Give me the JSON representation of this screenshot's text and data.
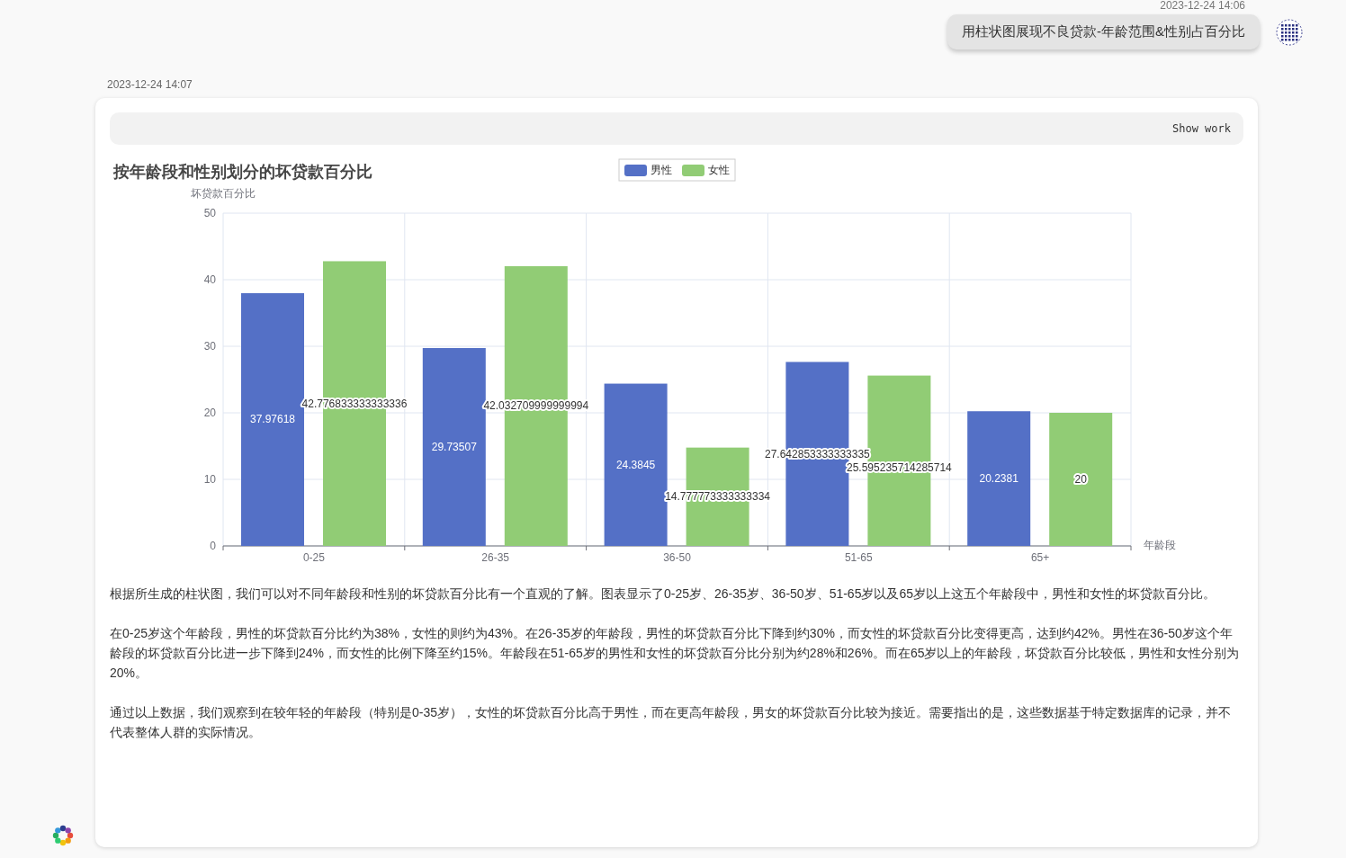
{
  "user_message": {
    "time": "2023-12-24 14:06",
    "text": "用柱状图展现不良贷款-年龄范围&性别占百分比"
  },
  "reply": {
    "time": "2023-12-24 14:07",
    "show_work": "Show work",
    "chart_data": {
      "type": "bar",
      "title": "按年龄段和性别划分的坏贷款百分比",
      "xlabel": "年龄段",
      "ylabel": "坏贷款百分比",
      "categories": [
        "0-25",
        "26-35",
        "36-50",
        "51-65",
        "65+"
      ],
      "series": [
        {
          "name": "男性",
          "color": "#5470c6",
          "values": [
            37.97618,
            29.73507,
            24.3845,
            27.642853333333335,
            20.2381
          ]
        },
        {
          "name": "女性",
          "color": "#91cc75",
          "values": [
            42.776833333333336,
            42.032709999999994,
            14.777773333333334,
            25.595235714285714,
            20
          ]
        }
      ],
      "ylim": [
        0,
        50
      ],
      "yticks": [
        0,
        10,
        20,
        30,
        40,
        50
      ],
      "data_labels": true,
      "grid": true,
      "legend": "top"
    },
    "paragraphs": [
      "根据所生成的柱状图，我们可以对不同年龄段和性别的坏贷款百分比有一个直观的了解。图表显示了0-25岁、26-35岁、36-50岁、51-65岁以及65岁以上这五个年龄段中，男性和女性的坏贷款百分比。",
      "在0-25岁这个年龄段，男性的坏贷款百分比约为38%，女性的则约为43%。在26-35岁的年龄段，男性的坏贷款百分比下降到约30%，而女性的坏贷款百分比变得更高，达到约42%。男性在36-50岁这个年龄段的坏贷款百分比进一步下降到24%，而女性的比例下降至约15%。年龄段在51-65岁的男性和女性的坏贷款百分比分别为约28%和26%。而在65岁以上的年龄段，坏贷款百分比较低，男性和女性分别为20%。",
      "通过以上数据，我们观察到在较年轻的年龄段（特别是0-35岁），女性的坏贷款百分比高于男性，而在更高年龄段，男女的坏贷款百分比较为接近。需要指出的是，这些数据基于特定数据库的记录，并不代表整体人群的实际情况。"
    ]
  }
}
